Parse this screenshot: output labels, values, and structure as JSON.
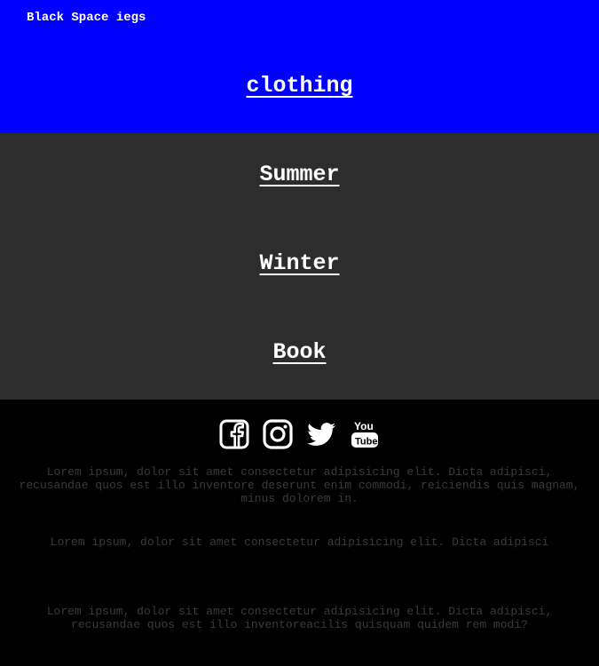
{
  "header": {
    "brand": "Black Space iegs",
    "title": "clothing",
    "background": "#0000ff"
  },
  "nav": {
    "background": "#2d2d2d",
    "items": [
      {
        "label": "Summer"
      },
      {
        "label": "Winter"
      },
      {
        "label": "Book"
      }
    ]
  },
  "footer": {
    "social_icons": [
      "facebook-icon",
      "instagram-icon",
      "twitter-icon",
      "youtube-icon"
    ],
    "paragraphs": [
      "Lorem ipsum, dolor sit amet consectetur adipisicing elit. Dicta adipisci, recusandae quos est illo inventore deserunt enim commodi, reiciendis quis magnam, minus dolorem in.",
      "Lorem ipsum, dolor sit amet consectetur adipisicing elit. Dicta adipisci",
      "Lorem ipsum, dolor sit amet consectetur adipisicing elit. Dicta adipisci, recusandae quos est illo inventoreacilis quisquam quidem rem modi?"
    ]
  }
}
